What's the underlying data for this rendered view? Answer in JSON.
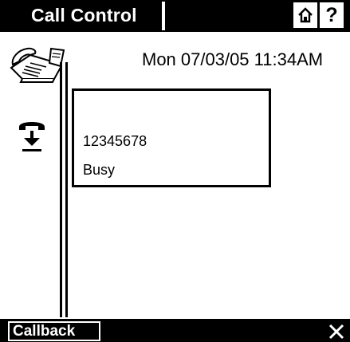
{
  "header": {
    "title": "Call Control",
    "home_icon": "home-icon",
    "help_label": "?"
  },
  "main": {
    "datetime": "Mon 07/03/05 11:34AM",
    "device_icon": "fax-machine-icon",
    "call_icon": "handset-receive-icon",
    "call": {
      "number": "12345678",
      "status": "Busy"
    }
  },
  "footer": {
    "softkey_label": "Callback",
    "close_icon": "close-icon"
  },
  "colors": {
    "bar_background": "#000000",
    "bar_text": "#ffffff",
    "content_background": "#ffffff"
  }
}
